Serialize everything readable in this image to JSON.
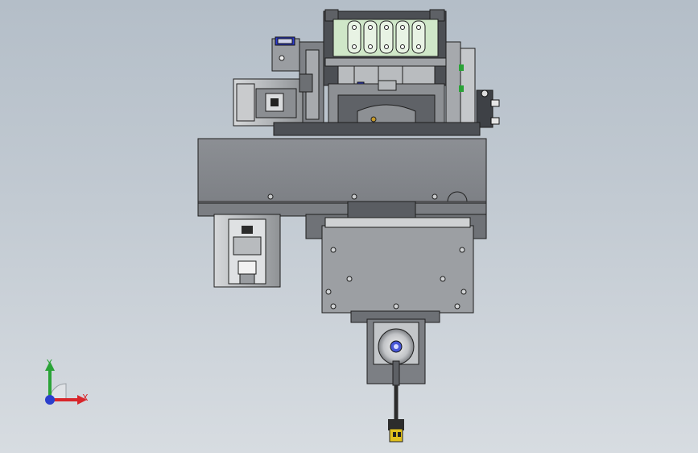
{
  "viewport": {
    "background_top": "#b4bec8",
    "background_bottom": "#d7dce1"
  },
  "triad": {
    "x_label": "X",
    "y_label": "Y",
    "x_color": "#d8262b",
    "y_color": "#2aa337",
    "z_color": "#2b3fcc"
  },
  "colors": {
    "steel_dark": "#5b5e63",
    "steel_mid": "#8a8d92",
    "steel_light": "#c8cacc",
    "plate": "#9c9fa3",
    "green_block": "#cfe7c8",
    "cable": "#2c2c2c",
    "connector": "#e1c11d",
    "accent_blue": "#2d3ccf"
  }
}
